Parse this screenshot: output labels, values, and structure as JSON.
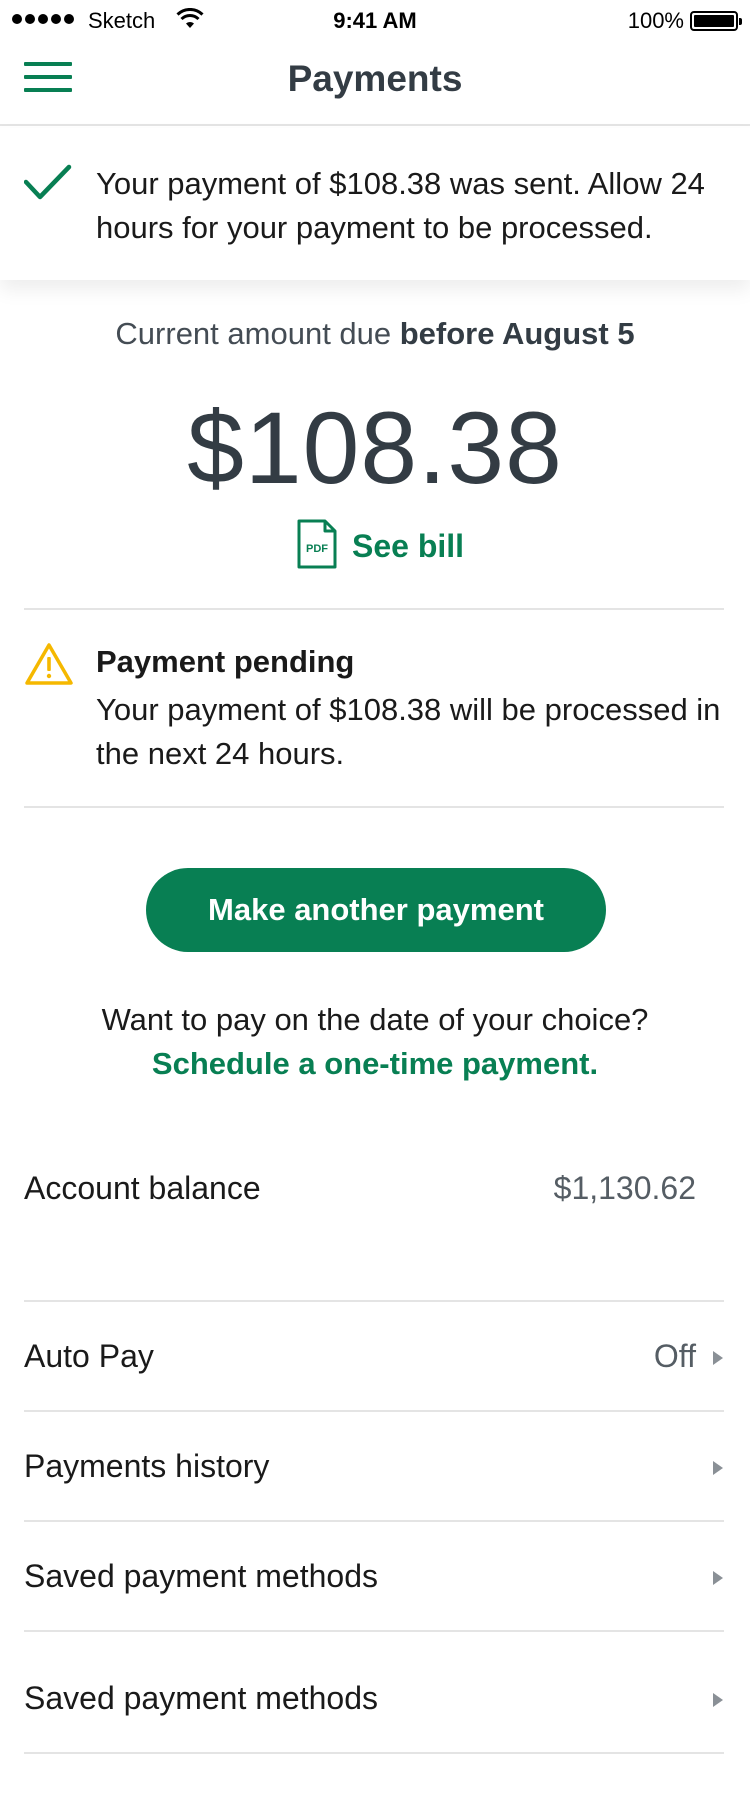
{
  "status_bar": {
    "carrier": "Sketch",
    "time": "9:41 AM",
    "battery": "100%"
  },
  "nav": {
    "title": "Payments"
  },
  "success_banner": {
    "message": "Your payment of $108.38 was sent. Allow 24 hours for your payment to be processed."
  },
  "due": {
    "label_prefix": "Current amount due ",
    "label_bold": "before August 5",
    "amount": "$108.38",
    "see_bill": "See bill",
    "pdf_icon_text": "PDF"
  },
  "pending": {
    "title": "Payment pending",
    "body": "Your payment of $108.38 will be processed in the next 24 hours."
  },
  "cta": {
    "label": "Make another payment"
  },
  "schedule": {
    "question": "Want to pay on the date of your choice?",
    "link": "Schedule a one-time payment."
  },
  "rows": [
    {
      "label": "Account balance",
      "value": "$1,130.62"
    },
    {
      "label": "Auto Pay",
      "value": "Off"
    },
    {
      "label": "Payments history",
      "value": ""
    },
    {
      "label": "Saved payment methods",
      "value": ""
    },
    {
      "label": "Saved payment methods",
      "value": ""
    }
  ],
  "colors": {
    "accent": "#087f53",
    "warning": "#f5b800",
    "text_dark": "#333c44"
  }
}
